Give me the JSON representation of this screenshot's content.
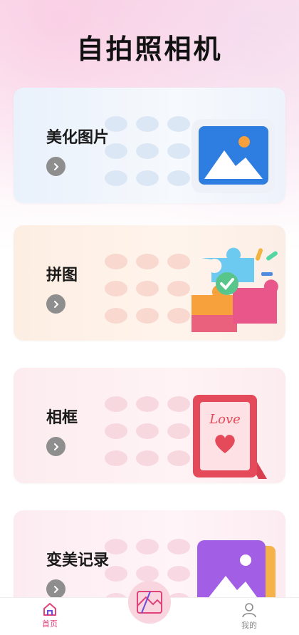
{
  "header": {
    "title": "自拍照相机"
  },
  "cards": [
    {
      "label": "美化图片"
    },
    {
      "label": "拼图"
    },
    {
      "label": "相框",
      "art_text": "Love"
    },
    {
      "label": "变美记录"
    }
  ],
  "bottom_nav": {
    "home_label": "首页",
    "mine_label": "我的"
  },
  "colors": {
    "accent": "#e0427a",
    "arrow": "#8e8e8e",
    "inactive": "#8a8a8a"
  }
}
